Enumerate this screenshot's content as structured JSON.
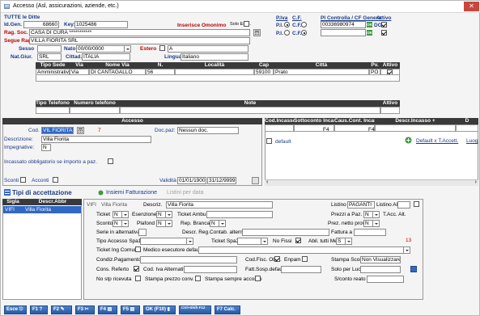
{
  "window": {
    "title": "Accesso (Asl, assicurazioni, aziende, etc.)",
    "close": "✕"
  },
  "header": {
    "tutte": "TUTTE le Ditte",
    "idgen_label": "Id.Gen.",
    "idgen_value": "68660",
    "key_label": "Key:",
    "key_value": "1025486",
    "omonimo": "Inserisce Omonimo",
    "solo_esist": "Solo Esist.",
    "ragsoc_label": "Rag. Soc.",
    "ragsoc_value": "CASA DI CURA ***********",
    "segue_label": "Segue Rag.",
    "segue_value": "VILLA FIORITA SRL",
    "sesso_label": "Sesso",
    "nato_label": "Nato il",
    "nato_value": "00/00/0000",
    "estero_label": "Estero",
    "estero_value": "A",
    "natgiur_label": "Nat.Giur.",
    "natgiur_value": "SRL",
    "cittad_label": "Cittad.",
    "cittad_value": "ITALIA",
    "lingua_label": "Lingua",
    "lingua_value": "Italiano",
    "piva_label": "P.Iva",
    "cf_label": "C.F.",
    "pi_label": "P.I.",
    "pi2_label": "P.I.",
    "cf_small": "C.F.",
    "cf_small2": "C.F.",
    "picf_label": "PI Controlla / CF Genera",
    "piva_value": "00336980974",
    "attivo_label": "Attivo",
    "ok_label": "OK",
    "do_label": "DO"
  },
  "address": {
    "headers": [
      "Tipo Sede",
      "Via",
      "Nome Via",
      "N.",
      "Località",
      "Cap",
      "Città",
      "Pv.",
      "Attivo"
    ],
    "row": [
      "Amministrativa",
      "Via",
      "DI CANTAGALLO",
      "56",
      "",
      "59100",
      "Prato",
      "PO",
      ""
    ]
  },
  "phone": {
    "headers": [
      "Tipo Telefono",
      "Numero telefono",
      "Note",
      "Attivo"
    ]
  },
  "accesso": {
    "title": "Accesso",
    "cod_label": "Cod.",
    "cod_value": "VIL FIORITA",
    "cod_num": "7",
    "docpaz_label": "Doc.paz:",
    "docpaz_value": "Nessun doc.",
    "desc_label": "Descrizione:",
    "desc_value": "Villa Fiorita",
    "impegn_label": "Impegnative:",
    "impegn_value": "N",
    "incassato": "Incassato obbligatorio se importo a paz.",
    "sconti": "Sconti",
    "acconti": "Acconti",
    "validita_label": "Validità",
    "val_from": "01/01/1900",
    "val_to": "31/12/9999"
  },
  "incasso": {
    "headers": [
      "Cod.Incasso",
      "Sottoconto Incasso",
      "Caus.Cont. Incasso",
      "Descr.Incasso +",
      "D"
    ],
    "f4a": "F4",
    "f4b": "F4",
    "default_label": "default",
    "default_btn": "Default x T.Accett.",
    "luogo": "Luog"
  },
  "tabs": {
    "tipi": "Tipi di accettazione",
    "insiemi": "Insiemi Fatturazione",
    "listini": "Listini per data"
  },
  "list": {
    "headers": [
      "Sigla",
      "Descr.Abbr"
    ],
    "rows": [
      [
        "VIFI",
        "Villa Fiorita"
      ]
    ]
  },
  "detail": {
    "sigla": "VIFI",
    "abbr": "Villa Fiorita",
    "descr_label": "Descriz.",
    "descr_value": "Villa Fiorita",
    "listino_label": "Listino",
    "listino_value": "PAGANTI",
    "listino_alt": "Listino Alt.",
    "ticket_label": "Ticket",
    "ticket_value": "N",
    "esenzione_label": "Esenzione",
    "esenzione_value": "N",
    "ticketambu_label": "Ticket Ambu",
    "prezzi_label": "Prezzi a Paz.",
    "prezzi_value": "N",
    "tacc_label": "T.Acc. Alt.",
    "sconto_label": "Sconto",
    "sconto_value": "N",
    "plafond_label": "Plafond",
    "plafond_value": "N",
    "repbranca_label": "Rep. Branca",
    "repbranca_value": "N",
    "prezneto_label": "Prez. netto prov",
    "prezneto_value": "N",
    "serie_label": "Serie in alternativa",
    "descreg_label": "Descr. Reg.Contab. altern.",
    "fattura_label": "Fattura a",
    "tipoacc_label": "Tipo Accesso Spa1",
    "ticketspa2_label": "Ticket Spa2",
    "nofissi_label": "No Fissi",
    "abil_label": "Abil. tutti Medic",
    "abil_value": "S",
    "red13": "13",
    "ticketing_label": "Ticket Ing Comun",
    "medico_label": "Medico esecutore defaut",
    "condpag_label": "Condiz.Pagamento",
    "codfisc_label": "Cod.Fisc. Obbl.",
    "enpam_label": "Enpam",
    "stampa_label": "Stampa Sconto",
    "stampa_value": "Non Visualizzare",
    "consref_label": "Cons. Referto",
    "codiva_label": "Cod. Iva Alternativa",
    "fatt_label": "Fatt.Sosp.default",
    "solo_label": "Solo per Luogo",
    "nostp_label": "No stp ricevuta",
    "stprezzo_label": "Stampa prezzo conv.",
    "stsempre_label": "Stampa sempre acconto",
    "sconto_reato": "S/conto reato"
  },
  "bottom": {
    "esce": "Esce",
    "f1": "F1 ?",
    "f2": "F2",
    "f3": "F3",
    "f4": "F4",
    "f5": "F5",
    "ok": "OK (F10)",
    "ctrlshift": "Ctrl+Shift F12",
    "f7": "F7 Calc."
  },
  "colors": {
    "accent": "#3168c4",
    "red": "#c00000",
    "dark_header": "#3a3a3a"
  }
}
